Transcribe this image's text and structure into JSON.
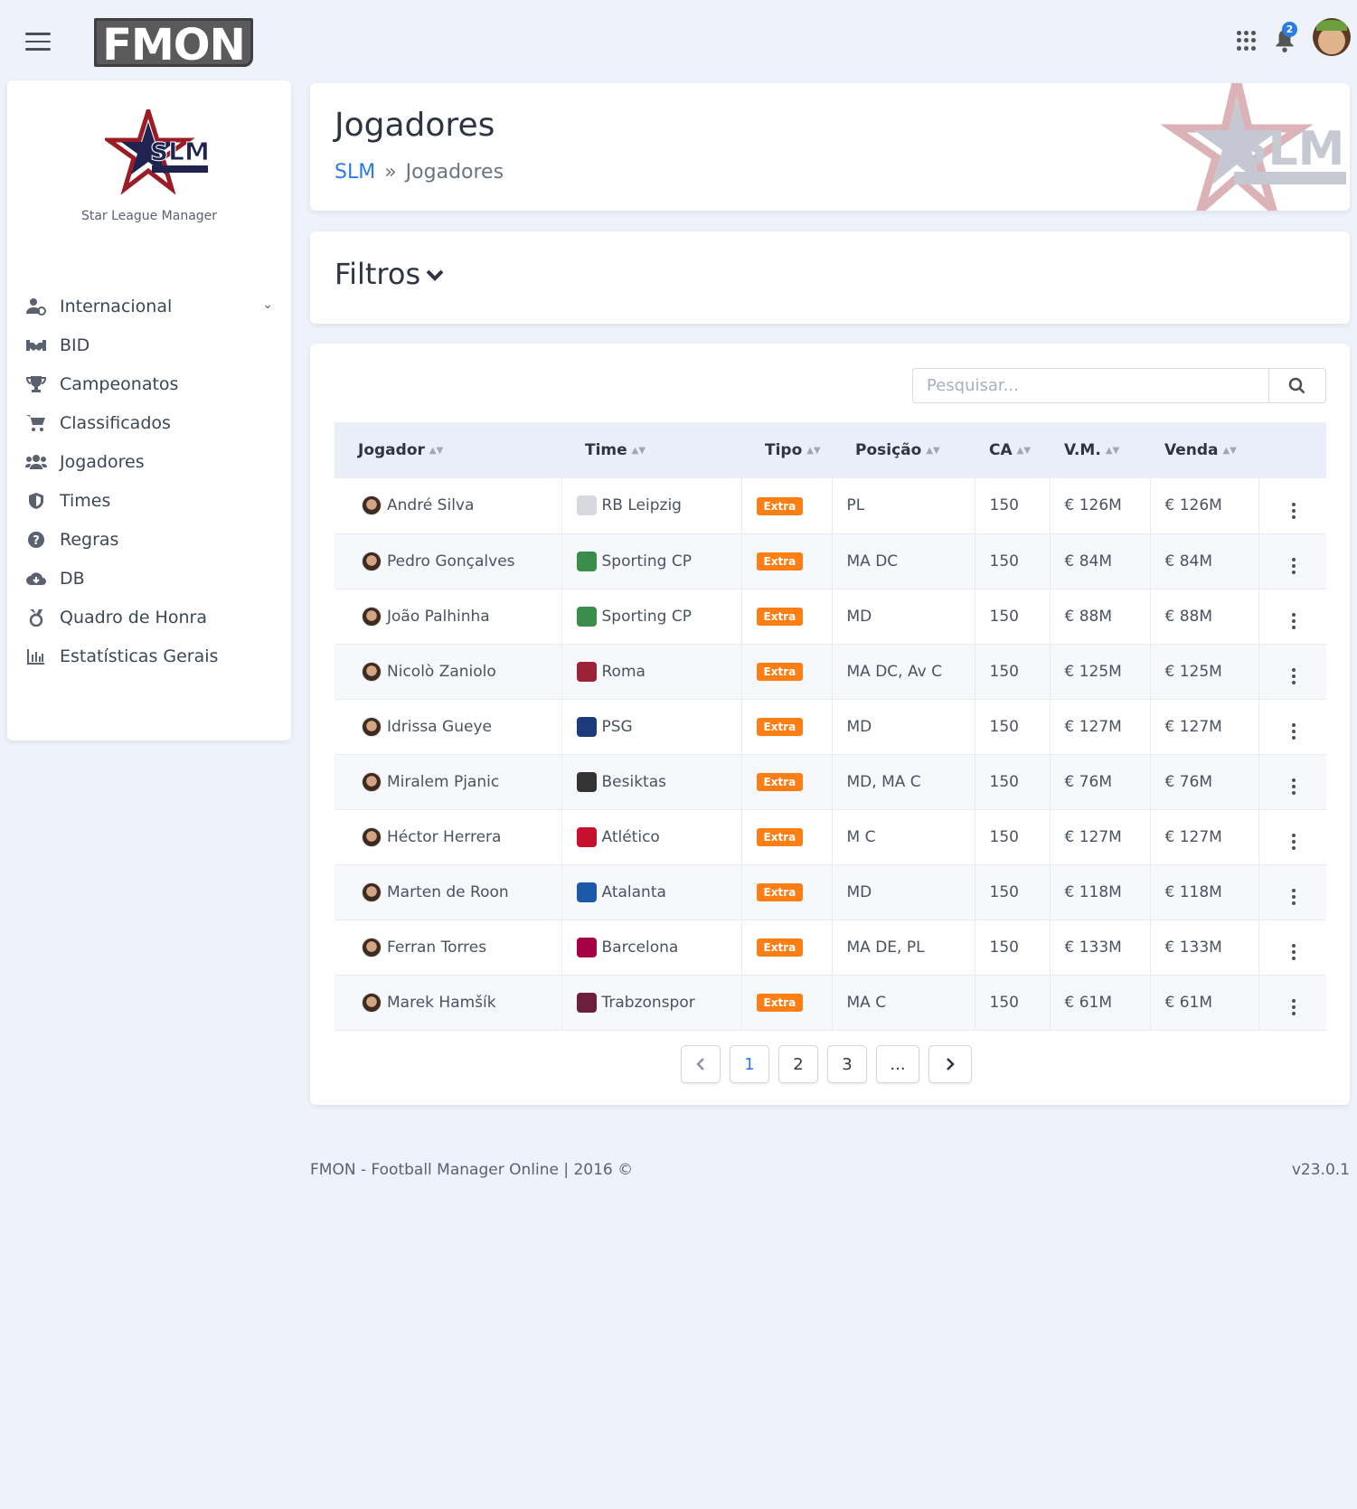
{
  "app": {
    "logo_text": "FMON",
    "notification_count": "2"
  },
  "sidebar": {
    "brand_name": "Star League Manager",
    "logo_text": "SLM",
    "items": [
      {
        "label": "Internacional",
        "icon": "user-cog-icon",
        "has_submenu": true
      },
      {
        "label": "BID",
        "icon": "handshake-icon"
      },
      {
        "label": "Campeonatos",
        "icon": "trophy-icon"
      },
      {
        "label": "Classificados",
        "icon": "cart-icon"
      },
      {
        "label": "Jogadores",
        "icon": "users-icon"
      },
      {
        "label": "Times",
        "icon": "shield-icon"
      },
      {
        "label": "Regras",
        "icon": "question-circle-icon"
      },
      {
        "label": "DB",
        "icon": "cloud-download-icon"
      },
      {
        "label": "Quadro de Honra",
        "icon": "medal-icon"
      },
      {
        "label": "Estatísticas Gerais",
        "icon": "bar-chart-icon"
      }
    ]
  },
  "header": {
    "title": "Jogadores",
    "breadcrumb_root": "SLM",
    "breadcrumb_sep": "»",
    "breadcrumb_current": "Jogadores"
  },
  "filters": {
    "title": "Filtros"
  },
  "search": {
    "placeholder": "Pesquisar..."
  },
  "table": {
    "columns": [
      "Jogador",
      "Time",
      "Tipo",
      "Posição",
      "CA",
      "V.M.",
      "Venda"
    ],
    "rows": [
      {
        "player": "André Silva",
        "team": "RB Leipzig",
        "type": "Extra",
        "position": "PL",
        "ca": "150",
        "vm": "€ 126M",
        "sale": "€ 126M",
        "crest": "#d8d8e0"
      },
      {
        "player": "Pedro Gonçalves",
        "team": "Sporting CP",
        "type": "Extra",
        "position": "MA DC",
        "ca": "150",
        "vm": "€ 84M",
        "sale": "€ 84M",
        "crest": "#3a8d4a"
      },
      {
        "player": "João Palhinha",
        "team": "Sporting CP",
        "type": "Extra",
        "position": "MD",
        "ca": "150",
        "vm": "€ 88M",
        "sale": "€ 88M",
        "crest": "#3a8d4a"
      },
      {
        "player": "Nicolò Zaniolo",
        "team": "Roma",
        "type": "Extra",
        "position": "MA DC, Av C",
        "ca": "150",
        "vm": "€ 125M",
        "sale": "€ 125M",
        "crest": "#9b2335"
      },
      {
        "player": "Idrissa Gueye",
        "team": "PSG",
        "type": "Extra",
        "position": "MD",
        "ca": "150",
        "vm": "€ 127M",
        "sale": "€ 127M",
        "crest": "#1d3a7a"
      },
      {
        "player": "Miralem Pjanic",
        "team": "Besiktas",
        "type": "Extra",
        "position": "MD, MA C",
        "ca": "150",
        "vm": "€ 76M",
        "sale": "€ 76M",
        "crest": "#333333"
      },
      {
        "player": "Héctor Herrera",
        "team": "Atlético",
        "type": "Extra",
        "position": "M C",
        "ca": "150",
        "vm": "€ 127M",
        "sale": "€ 127M",
        "crest": "#c8102e"
      },
      {
        "player": "Marten de Roon",
        "team": "Atalanta",
        "type": "Extra",
        "position": "MD",
        "ca": "150",
        "vm": "€ 118M",
        "sale": "€ 118M",
        "crest": "#1c5aa8"
      },
      {
        "player": "Ferran Torres",
        "team": "Barcelona",
        "type": "Extra",
        "position": "MA DE, PL",
        "ca": "150",
        "vm": "€ 133M",
        "sale": "€ 133M",
        "crest": "#a50044"
      },
      {
        "player": "Marek Hamšík",
        "team": "Trabzonspor",
        "type": "Extra",
        "position": "MA C",
        "ca": "150",
        "vm": "€ 61M",
        "sale": "€ 61M",
        "crest": "#6b1f3c"
      }
    ]
  },
  "pagination": {
    "pages": [
      "1",
      "2",
      "3",
      "..."
    ],
    "current": "1"
  },
  "footer": {
    "left": "FMON - Football Manager Online | 2016 ©",
    "right": "v23.0.1"
  },
  "colors": {
    "accent": "#2c7be5",
    "badge_extra": "#fd7e14",
    "background": "#eef2fa"
  }
}
